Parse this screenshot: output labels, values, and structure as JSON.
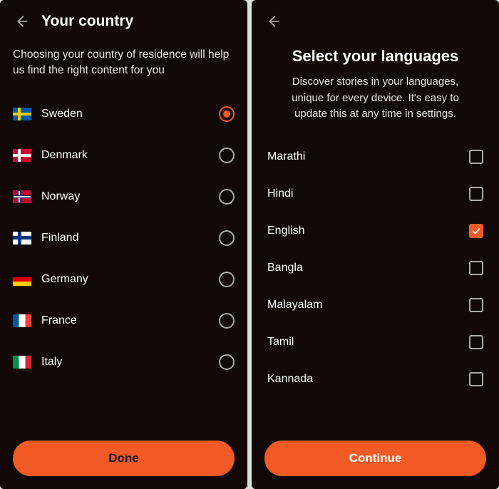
{
  "screen1": {
    "title": "Your country",
    "subtitle": "Choosing your country of residence will help us find the right content for you",
    "cta_label": "Done",
    "countries": [
      {
        "name": "Sweden",
        "flag_class": "flag-se",
        "selected": true
      },
      {
        "name": "Denmark",
        "flag_class": "flag-dk",
        "selected": false
      },
      {
        "name": "Norway",
        "flag_class": "flag-no",
        "selected": false
      },
      {
        "name": "Finland",
        "flag_class": "flag-fi",
        "selected": false
      },
      {
        "name": "Germany",
        "flag_class": "flag-de",
        "selected": false
      },
      {
        "name": "France",
        "flag_class": "flag-fr",
        "selected": false
      },
      {
        "name": "Italy",
        "flag_class": "flag-it",
        "selected": false
      }
    ]
  },
  "screen2": {
    "title": "Select your languages",
    "subtitle": "Discover stories in your languages, unique for every device. It's easy to update this at any time in settings.",
    "cta_label": "Continue",
    "languages": [
      {
        "name": "Marathi",
        "checked": false
      },
      {
        "name": "Hindi",
        "checked": false
      },
      {
        "name": "English",
        "checked": true
      },
      {
        "name": "Bangla",
        "checked": false
      },
      {
        "name": "Malayalam",
        "checked": false
      },
      {
        "name": "Tamil",
        "checked": false
      },
      {
        "name": "Kannada",
        "checked": false
      }
    ]
  }
}
